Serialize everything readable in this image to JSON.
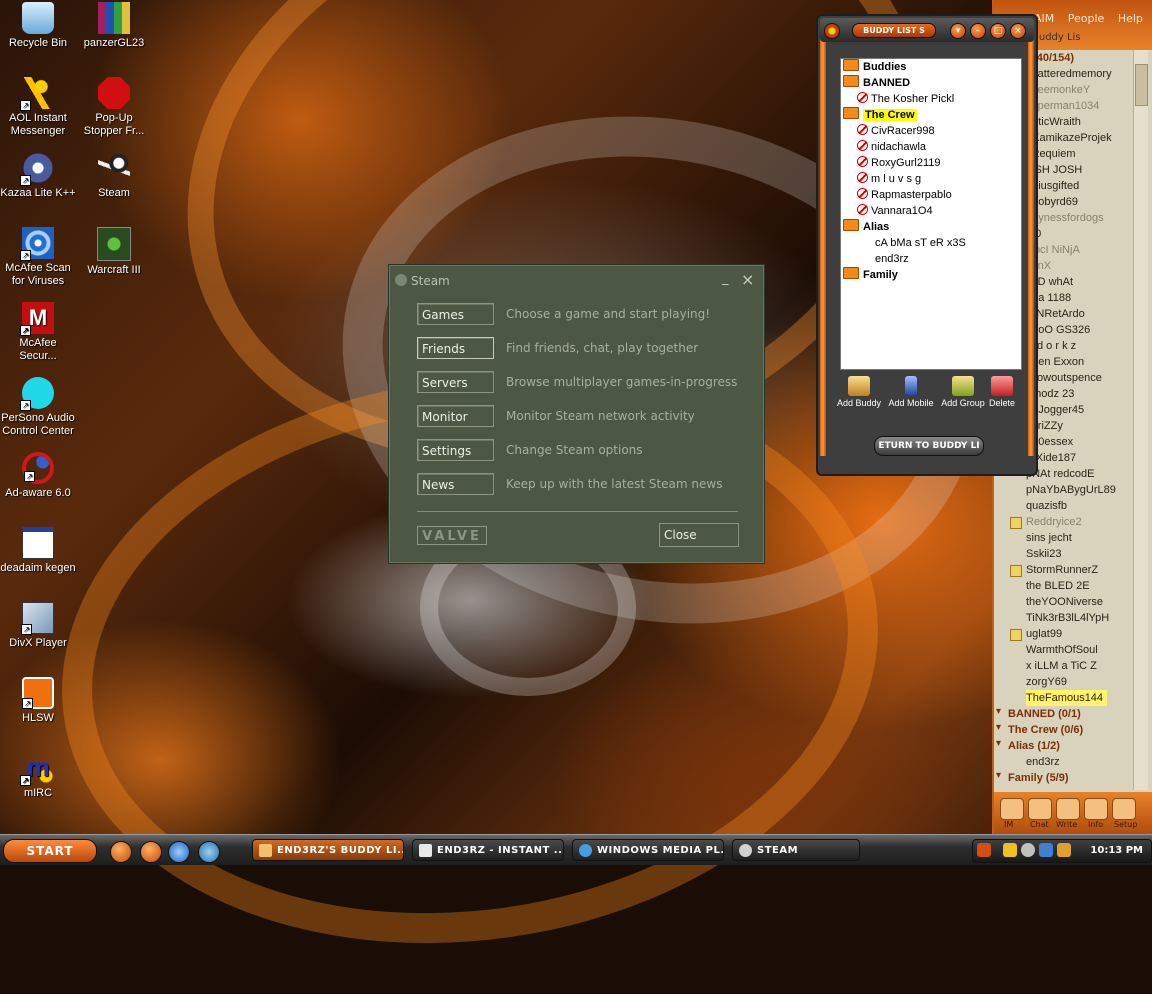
{
  "desktop": {
    "icons": [
      {
        "label": "Recycle Bin",
        "icon": "recycle-bin-icon"
      },
      {
        "label": "panzerGL23",
        "icon": "winrar-archive-icon"
      },
      {
        "label": "AOL Instant Messenger",
        "icon": "aim-running-man-icon"
      },
      {
        "label": "Pop-Up Stopper Fr...",
        "icon": "popup-stopper-icon"
      },
      {
        "label": "Kazaa Lite K++",
        "icon": "kazaa-icon"
      },
      {
        "label": "Steam",
        "icon": "steam-icon"
      },
      {
        "label": "McAfee Scan for Viruses",
        "icon": "mcafee-scan-icon"
      },
      {
        "label": "Warcraft III",
        "icon": "warcraft-icon"
      },
      {
        "label": "McAfee Secur...",
        "icon": "mcafee-security-icon"
      },
      {
        "label": "PerSono Audio Control Center",
        "icon": "audio-control-icon"
      },
      {
        "label": "Ad-aware 6.0",
        "icon": "adaware-icon"
      },
      {
        "label": "deadaim kegen",
        "icon": "application-window-icon"
      },
      {
        "label": "DivX Player",
        "icon": "divx-icon"
      },
      {
        "label": "HLSW",
        "icon": "hlsw-icon"
      },
      {
        "label": "mIRC",
        "icon": "mirc-icon"
      }
    ]
  },
  "steam": {
    "title": "Steam",
    "minimize": "_",
    "close_x": "×",
    "items": [
      {
        "button": "Games",
        "desc": "Choose a game and start playing!"
      },
      {
        "button": "Friends",
        "desc": "Find friends, chat, play together"
      },
      {
        "button": "Servers",
        "desc": "Browse multiplayer games-in-progress"
      },
      {
        "button": "Monitor",
        "desc": "Monitor Steam network activity"
      },
      {
        "button": "Settings",
        "desc": "Change Steam options"
      },
      {
        "button": "News",
        "desc": "Keep up with the latest Steam news"
      }
    ],
    "valve_logo": "VALVE",
    "close_button": "Close"
  },
  "buddy_small": {
    "title": "BUDDY LIST S",
    "tree": [
      {
        "type": "group",
        "label": "Buddies"
      },
      {
        "type": "group",
        "label": "BANNED"
      },
      {
        "type": "blocked",
        "label": "The Kosher Pickl"
      },
      {
        "type": "group-hl",
        "label": "The Crew"
      },
      {
        "type": "blocked",
        "label": "CivRacer998"
      },
      {
        "type": "blocked",
        "label": "nidachawla"
      },
      {
        "type": "blocked",
        "label": "RoxyGurl2119"
      },
      {
        "type": "blocked",
        "label": "m l u v s g"
      },
      {
        "type": "blocked",
        "label": "Rapmasterpablo"
      },
      {
        "type": "blocked",
        "label": "Vannara1O4"
      },
      {
        "type": "group",
        "label": "Alias"
      },
      {
        "type": "plain",
        "label": "cA bMa sT eR x3S"
      },
      {
        "type": "plain",
        "label": "end3rz"
      },
      {
        "type": "group",
        "label": "Family"
      }
    ],
    "actions": [
      "Add Buddy",
      "Add Mobile",
      "Add Group",
      "Delete"
    ],
    "return_button": "ETURN TO BUDDY LI"
  },
  "buddy_big": {
    "menus": [
      "AIM",
      "People",
      "Help"
    ],
    "title": "Buddy Lis",
    "rows": [
      {
        "t": "grp",
        "label": "dies (40/154)"
      },
      {
        "t": "n",
        "label": "chatteredmemory"
      },
      {
        "t": "i",
        "label": "ybeemonkeY"
      },
      {
        "t": "i",
        "label": "superman1034"
      },
      {
        "t": "n",
        "label": "aoticWraith"
      },
      {
        "t": "n",
        "label": "oKamikazeProjek"
      },
      {
        "t": "n",
        "label": "l Requiem"
      },
      {
        "t": "n",
        "label": "OSH      JOSH"
      },
      {
        "t": "n",
        "label": "eniusgifted"
      },
      {
        "t": "n",
        "label": "ettobyrd69"
      },
      {
        "t": "i",
        "label": "ppynessfordogs"
      },
      {
        "t": "n",
        "label": "f10"
      },
      {
        "t": "i",
        "label": "DocI NiNjA"
      },
      {
        "t": "i",
        "label": "sanX"
      },
      {
        "t": "n",
        "label": "seD whAt"
      },
      {
        "t": "n",
        "label": "nna 1188"
      },
      {
        "t": "n",
        "label": "PtNRetArdo"
      },
      {
        "t": "n",
        "label": "M oO  GS326"
      },
      {
        "t": "n",
        "label": "yxd o r k z"
      },
      {
        "t": "n",
        "label": "onen Exxon"
      },
      {
        "t": "n",
        "label": "ellowoutspence"
      },
      {
        "t": "n",
        "label": "ethodz 23"
      },
      {
        "t": "n",
        "label": "ndJogger45"
      },
      {
        "t": "n",
        "label": "cTriZZy"
      },
      {
        "t": "n",
        "label": "e80essex"
      },
      {
        "t": "n",
        "label": "roXide187"
      },
      {
        "t": "n",
        "label": "pNAt redcodE"
      },
      {
        "t": "n",
        "label": "pNaYbABygUrL89"
      },
      {
        "t": "n",
        "label": "quazisfb"
      },
      {
        "t": "i",
        "label": "Reddryice2"
      },
      {
        "t": "n",
        "label": "sins jecht"
      },
      {
        "t": "n",
        "label": "Sskii23"
      },
      {
        "t": "n",
        "label": "StormRunnerZ"
      },
      {
        "t": "n",
        "label": "the BLED 2E"
      },
      {
        "t": "n",
        "label": "theYOONiverse"
      },
      {
        "t": "n",
        "label": "TiNk3rB3lL4lYpH"
      },
      {
        "t": "n",
        "label": "uglat99"
      },
      {
        "t": "n",
        "label": "WarmthOfSoul"
      },
      {
        "t": "n",
        "label": "x iLLM a TiC Z"
      },
      {
        "t": "n",
        "label": "zorgY69"
      },
      {
        "t": "h",
        "label": "TheFamous144"
      },
      {
        "t": "grp",
        "label": "BANNED (0/1)"
      },
      {
        "t": "grp",
        "label": "The Crew (0/6)"
      },
      {
        "t": "grp",
        "label": "Alias (1/2)"
      },
      {
        "t": "n",
        "label": "end3rz"
      },
      {
        "t": "grp",
        "label": "Family (5/9)"
      }
    ],
    "footer": [
      "IM",
      "Chat",
      "Write",
      "Info",
      "Setup"
    ]
  },
  "taskbar": {
    "start": "START",
    "tasks": [
      {
        "label": "END3RZ'S BUDDY LI..."
      },
      {
        "label": "END3RZ - INSTANT ..."
      },
      {
        "label": "WINDOWS MEDIA PL..."
      },
      {
        "label": "STEAM"
      }
    ],
    "clock": "10:13 PM"
  },
  "colors": {
    "accent": "#e07020",
    "steam_bg": "#4c5844",
    "highlight": "#ffff00"
  }
}
